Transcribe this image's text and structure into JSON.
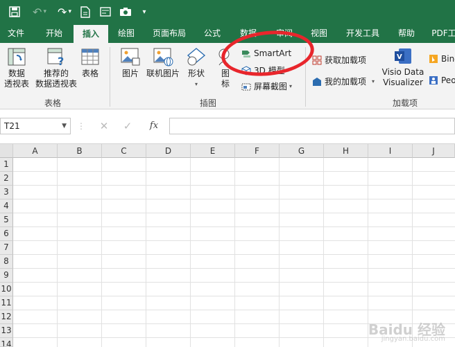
{
  "quick_access": {
    "save_icon": "save-icon",
    "undo_icon": "undo-icon",
    "redo_icon": "redo-icon",
    "file_icon": "document-icon",
    "form_icon": "form-icon",
    "camera_icon": "camera-icon",
    "customize_icon": "dropdown-icon"
  },
  "tabs": [
    "文件",
    "开始",
    "插入",
    "绘图",
    "页面布局",
    "公式",
    "数据",
    "审阅",
    "视图",
    "开发工具",
    "帮助",
    "PDF工"
  ],
  "active_tab": "插入",
  "ribbon": {
    "tables_group": {
      "label": "表格",
      "pivot": "数据\n透视表",
      "recommended_pivot": "推荐的\n数据透视表",
      "table": "表格"
    },
    "illustrations_group": {
      "label": "插图",
      "pictures": "图片",
      "online_pictures": "联机图片",
      "shapes": "形状",
      "icons": "图\n标",
      "smartart": "SmartArt",
      "model3d": "3D 模型",
      "screenshot": "屏幕截图"
    },
    "addins_group": {
      "label": "加载项",
      "get_addins": "获取加载项",
      "my_addins": "我的加载项",
      "visio": "Visio Data\nVisualizer",
      "bing": "Bing",
      "people": "Peo"
    }
  },
  "formula_bar": {
    "name_box": "T21",
    "cancel": "✕",
    "enter": "✓",
    "fx": "fx",
    "value": ""
  },
  "grid": {
    "columns": [
      "A",
      "B",
      "C",
      "D",
      "E",
      "F",
      "G",
      "H",
      "I",
      "J"
    ],
    "rows": [
      "1",
      "2",
      "3",
      "4",
      "5",
      "6",
      "7",
      "8",
      "9",
      "10",
      "11",
      "12",
      "13",
      "14"
    ]
  },
  "watermark": {
    "text": "Baidu 经验",
    "url": "jingyan.baidu.com"
  },
  "colors": {
    "excel_green": "#217346",
    "annotation_red": "#e8262c"
  }
}
